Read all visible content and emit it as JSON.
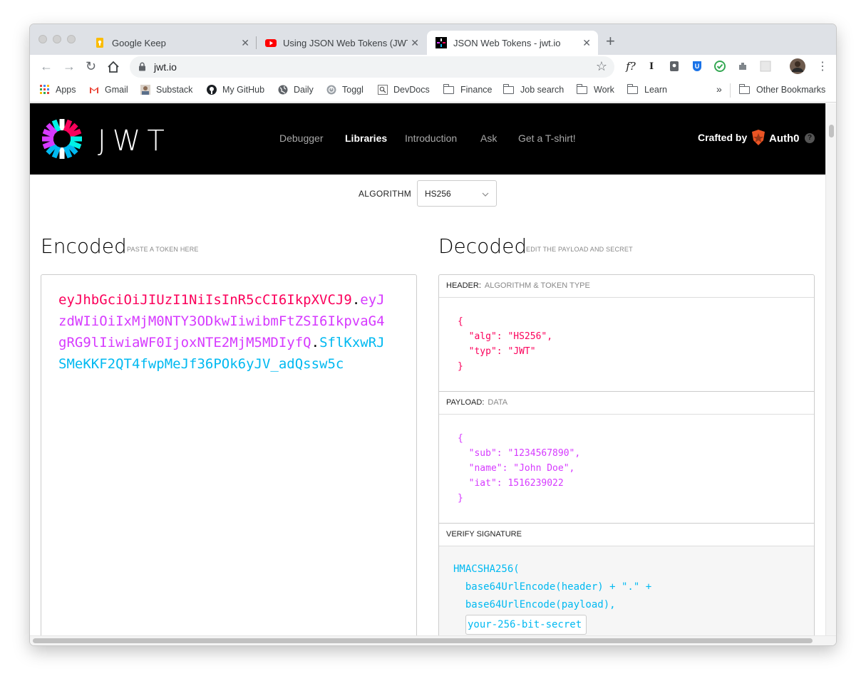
{
  "browser": {
    "tabs": [
      {
        "title": "Google Keep",
        "icon": "google-keep-icon"
      },
      {
        "title": "Using JSON Web Tokens (JWT",
        "icon": "youtube-icon"
      },
      {
        "title": "JSON Web Tokens - jwt.io",
        "icon": "jwt-favicon"
      }
    ],
    "new_tab": "+",
    "close": "✕",
    "url": "jwt.io",
    "bookmarks": [
      {
        "label": "Apps",
        "icon": "apps-grid-icon"
      },
      {
        "label": "Gmail",
        "icon": "gmail-icon"
      },
      {
        "label": "Substack",
        "icon": "substack-avatar-icon"
      },
      {
        "label": "My GitHub",
        "icon": "github-icon"
      },
      {
        "label": "Daily",
        "icon": "globe-icon"
      },
      {
        "label": "Toggl",
        "icon": "toggl-icon"
      },
      {
        "label": "DevDocs",
        "icon": "devdocs-icon"
      },
      {
        "label": "Finance",
        "icon": "folder-icon"
      },
      {
        "label": "Job search",
        "icon": "folder-icon"
      },
      {
        "label": "Work",
        "icon": "folder-icon"
      },
      {
        "label": "Learn",
        "icon": "folder-icon"
      }
    ],
    "overflow": "»",
    "other_bookmarks": "Other Bookmarks",
    "extensions": [
      "f?",
      "I"
    ]
  },
  "site": {
    "logo": "JWT",
    "nav": [
      "Debugger",
      "Libraries",
      "Introduction",
      "Ask",
      "Get a T-shirt!"
    ],
    "active_nav": "Libraries",
    "crafted_by": "Crafted by",
    "brand": "Auth0",
    "help": "?"
  },
  "algorithm": {
    "label": "ALGORITHM",
    "value": "HS256"
  },
  "encoded": {
    "title": "Encoded",
    "subtitle": "PASTE A TOKEN HERE",
    "header_part": "eyJhbGciOiJIUzI1NiIsInR5cCI6IkpXVCJ9",
    "payload_part": "eyJzdWIiOiIxMjM0NTY3ODkwIiwibmFtZSI6IkpvaG4gRG9lIiwiaWF0IjoxNTE2MjM5MDIyfQ",
    "signature_part": "SflKxwRJSMeKKF2QT4fwpMeJf36POk6yJV_adQssw5c",
    "dot": "."
  },
  "decoded": {
    "title": "Decoded",
    "subtitle": "EDIT THE PAYLOAD AND SECRET",
    "header": {
      "label": "HEADER:",
      "desc": "ALGORITHM & TOKEN TYPE",
      "json": "{\n  \"alg\": \"HS256\",\n  \"typ\": \"JWT\"\n}"
    },
    "payload": {
      "label": "PAYLOAD:",
      "desc": "DATA",
      "json": "{\n  \"sub\": \"1234567890\",\n  \"name\": \"John Doe\",\n  \"iat\": 1516239022\n}"
    },
    "signature": {
      "label": "VERIFY SIGNATURE",
      "line1": "HMACSHA256(",
      "line2": "  base64UrlEncode(header) + \".\" +",
      "line3": "  base64UrlEncode(payload),",
      "secret": "your-256-bit-secret"
    }
  },
  "colors": {
    "header_red": "#fb015b",
    "payload_purple": "#d63aff",
    "signature_cyan": "#00b9f1"
  }
}
